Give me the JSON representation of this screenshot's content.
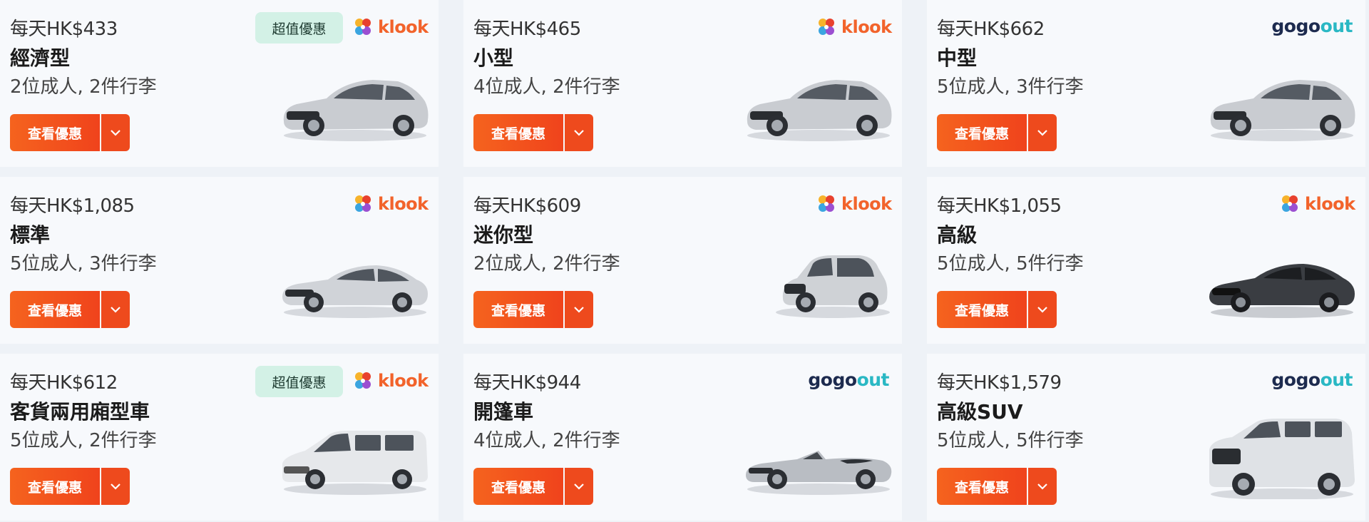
{
  "cards": [
    {
      "price": "每天HK$433",
      "class": "經濟型",
      "capacity": "2位成人, 2件行李",
      "cta": "查看優惠",
      "deal": "超值優惠",
      "provider": "klook"
    },
    {
      "price": "每天HK$465",
      "class": "小型",
      "capacity": "4位成人, 2件行李",
      "cta": "查看優惠",
      "provider": "klook"
    },
    {
      "price": "每天HK$662",
      "class": "中型",
      "capacity": "5位成人, 3件行李",
      "cta": "查看優惠",
      "provider": "gogoout"
    },
    {
      "price": "每天HK$1,085",
      "class": "標準",
      "capacity": "5位成人, 3件行李",
      "cta": "查看優惠",
      "provider": "klook"
    },
    {
      "price": "每天HK$609",
      "class": "迷你型",
      "capacity": "2位成人, 2件行李",
      "cta": "查看優惠",
      "provider": "klook"
    },
    {
      "price": "每天HK$1,055",
      "class": "高級",
      "capacity": "5位成人, 5件行李",
      "cta": "查看優惠",
      "provider": "klook"
    },
    {
      "price": "每天HK$612",
      "class": "客貨兩用廂型車",
      "capacity": "5位成人, 2件行李",
      "cta": "查看優惠",
      "deal": "超值優惠",
      "provider": "klook"
    },
    {
      "price": "每天HK$944",
      "class": "開篷車",
      "capacity": "4位成人, 2件行李",
      "cta": "查看優惠",
      "provider": "gogoout"
    },
    {
      "price": "每天HK$1,579",
      "class": "高級SUV",
      "capacity": "5位成人, 5件行李",
      "cta": "查看優惠",
      "provider": "gogoout"
    }
  ],
  "logos": {
    "klook": "klook",
    "gogoout_a": "gogo",
    "gogoout_b": "out"
  },
  "colors": {
    "cta": "#f05a1e",
    "deal_bg": "#d3f1e6",
    "klook": "#f2632b",
    "gogo_dark": "#1d2b4f",
    "gogo_teal": "#2ab8c4"
  },
  "icons": {
    "dropdown": "chevron-down-icon",
    "car": "car-image",
    "klook_mark": "klook-pinwheel-icon"
  }
}
